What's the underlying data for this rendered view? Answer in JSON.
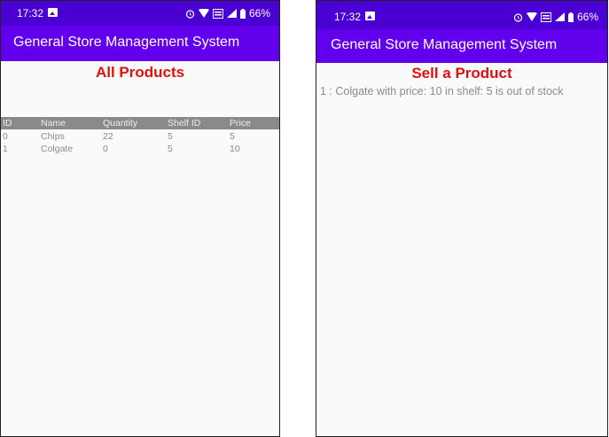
{
  "left_screen": {
    "status": {
      "time": "17:32",
      "battery": "66%"
    },
    "app_title": "General Store Management System",
    "heading": "All Products",
    "table": {
      "headers": {
        "id": "ID",
        "name": "Name",
        "quantity": "Quantity",
        "shelf_id": "Shelf ID",
        "price": "Price"
      },
      "rows": [
        {
          "id": "0",
          "name": "Chips",
          "quantity": "22",
          "shelf_id": "5",
          "price": "5"
        },
        {
          "id": "1",
          "name": "Colgate",
          "quantity": "0",
          "shelf_id": "5",
          "price": "10"
        }
      ]
    }
  },
  "right_screen": {
    "status": {
      "time": "17:32",
      "battery": "66%"
    },
    "app_title": "General Store Management System",
    "heading": "Sell a Product",
    "message": "1 : Colgate with price: 10 in shelf: 5 is out of stock"
  },
  "colors": {
    "status_bar": "#4b00d3",
    "app_bar": "#6200ee",
    "heading": "#e01010",
    "table_header_bg": "#8a8a8a"
  }
}
